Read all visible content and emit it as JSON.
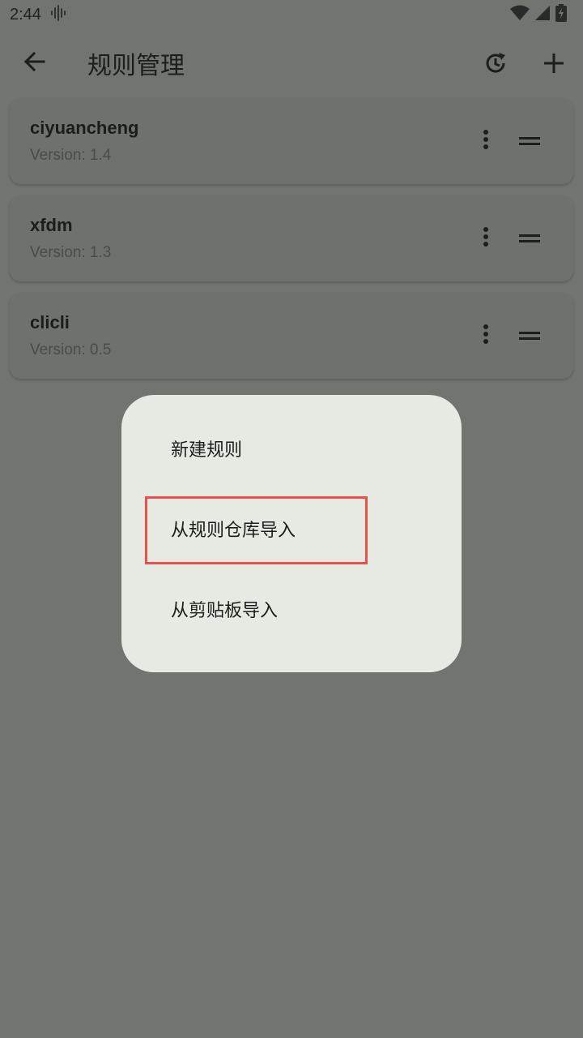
{
  "status_bar": {
    "time": "2:44"
  },
  "app_bar": {
    "title": "规则管理"
  },
  "rules": [
    {
      "name": "ciyuancheng",
      "version": "Version: 1.4"
    },
    {
      "name": "xfdm",
      "version": "Version: 1.3"
    },
    {
      "name": "clicli",
      "version": "Version: 0.5"
    }
  ],
  "menu": {
    "items": [
      {
        "label": "新建规则"
      },
      {
        "label": "从规则仓库导入"
      },
      {
        "label": "从剪贴板导入"
      }
    ]
  },
  "colors": {
    "highlight": "#e9504e",
    "scrim": "#727470",
    "dialog": "#e7e9e3"
  }
}
